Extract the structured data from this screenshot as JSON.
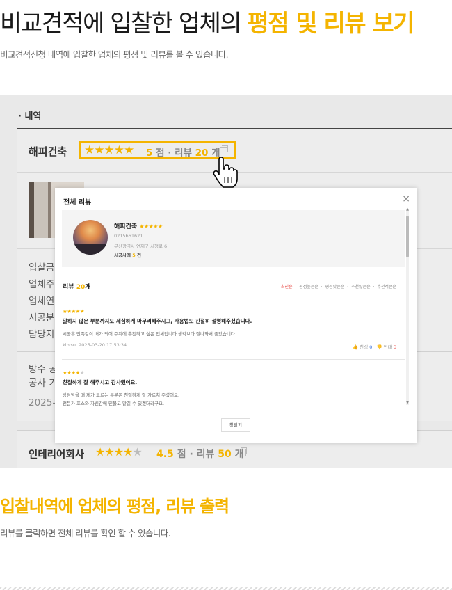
{
  "header": {
    "title_main": "비교견적에 입찰한 업체의 ",
    "title_highlight": "평점 및 리뷰 보기",
    "subtitle": "비교견적신청 내역에 입찰한 업체의 평점 및 리뷰를 볼 수 있습니다."
  },
  "panel": {
    "label": "· 내역",
    "company1": {
      "name": "해피건축",
      "stars": "★★★★★",
      "score_value": "5",
      "score_unit": "점",
      "dot": "·",
      "review_label": "리뷰",
      "review_count": "20",
      "review_unit": "개",
      "rating": 5
    },
    "info_labels": [
      "입찰금",
      "업체주",
      "업체연",
      "시공분",
      "담당지"
    ],
    "desc_lines": [
      "방수 공",
      "공사 기"
    ],
    "date_partial": "2025-0",
    "company2": {
      "name": "인테리어회사",
      "stars_full": "★★★★",
      "stars_half": "★",
      "score_value": "4.5",
      "score_unit": "점",
      "dot": "·",
      "review_label": "리뷰",
      "review_count": "50",
      "review_unit": "개",
      "rating": 4.5
    }
  },
  "modal": {
    "title": "전체 리뷰",
    "close_icon": "×",
    "profile": {
      "name": "해피건축",
      "stars": "★★★★★",
      "phone": "0215661621",
      "address": "부산광역시 연제구 시청로 6",
      "count_prefix": "시공사례 ",
      "count_value": "5",
      "count_suffix": " 건"
    },
    "reviews_label": "리뷰",
    "reviews_count": "20",
    "reviews_unit": "개",
    "sorts": [
      "최신순",
      "·",
      "평점높은순",
      "·",
      "평점낮은순",
      "·",
      "추천많은순",
      "·",
      "추천적은순"
    ],
    "reviews": [
      {
        "stars": "★★★★★",
        "stars_dim": "",
        "title": "말하지 않은 부분까지도 세심하게 마무리해주시고, 사용법도 친절히 설명해주셨습니다.",
        "body": "시공후 만족감이 배가 되어 주위에 추천하고 싶은 업체입니다 생각보다 잘나와서 좋았습니다",
        "author": "kibisu",
        "datetime": "2025-03-20 17:53:34",
        "like_label": "찬성",
        "like_count": "0",
        "dislike_label": "반대",
        "dislike_count": "0"
      },
      {
        "stars": "★★★★",
        "stars_dim": "★",
        "title": "친절하게 잘 해주시고 감사했어요.",
        "body1": "상담받을 때 제가 모르는 부분은 친절하게 잘 가르쳐 주셨어요.",
        "body2": "전문가 포스와 자신감에 믿볼고 맡길 수 있겠더라구요."
      }
    ],
    "close_button": "창닫기"
  },
  "section2": {
    "title": "입찰내역에 업체의 평점, 리뷰 출력",
    "subtitle": "리뷰를 클릭하면 전체 리뷰를 확인 할 수 있습니다."
  },
  "icons": {
    "copy": "copy-icon",
    "cursor": "hand-pointer-icon",
    "star": "star-icon",
    "close": "close-icon",
    "thumb_up": "thumb-up-icon",
    "thumb_down": "thumb-down-icon"
  },
  "colors": {
    "accent": "#f4b400",
    "red": "#e53935",
    "blue": "#3b6fd8"
  }
}
